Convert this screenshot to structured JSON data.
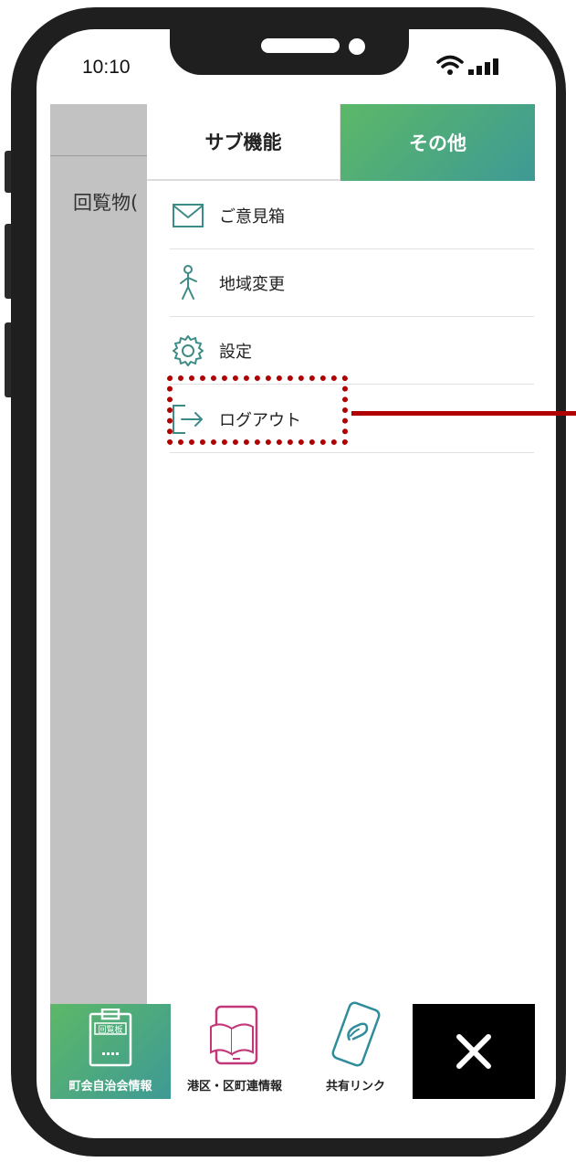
{
  "status_bar": {
    "time": "10:10"
  },
  "background_page": {
    "title_fragment": "回覧物("
  },
  "drawer": {
    "tabs": [
      {
        "label": "サブ機能",
        "active": false
      },
      {
        "label": "その他",
        "active": true
      }
    ],
    "menu_items": [
      {
        "label": "ご意見箱",
        "icon": "envelope-icon"
      },
      {
        "label": "地域変更",
        "icon": "walking-person-icon"
      },
      {
        "label": "設定",
        "icon": "gear-icon"
      },
      {
        "label": "ログアウト",
        "icon": "logout-icon"
      }
    ]
  },
  "bottom_nav": {
    "items": [
      {
        "label": "町会自治会情報",
        "icon": "clipboard-icon",
        "icon_text": "回覧板",
        "active": true
      },
      {
        "label": "港区・区町連情報",
        "icon": "tablet-book-icon",
        "active": false
      },
      {
        "label": "共有リンク",
        "icon": "phone-link-icon",
        "active": false
      }
    ],
    "close": {
      "icon": "close-icon"
    }
  },
  "colors": {
    "accent_green": "#5cb867",
    "accent_teal": "#3e9a95",
    "icon_teal": "#3d8b86",
    "highlight_red": "#b00000"
  }
}
